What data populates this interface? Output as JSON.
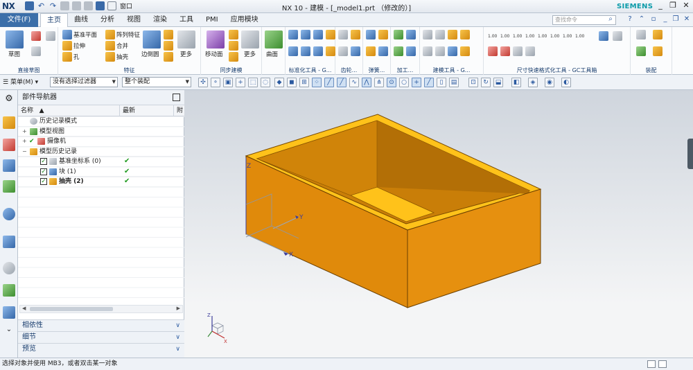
{
  "app": {
    "logo": "NX",
    "title": "NX 10 - 建模 - [_model1.prt （修改的）]",
    "brand": "SIEMENS",
    "window_menu": "窗口"
  },
  "ribbon_tabs": {
    "file": "文件(F)",
    "items": [
      "主页",
      "曲线",
      "分析",
      "视图",
      "渲染",
      "工具",
      "PMI",
      "应用模块"
    ],
    "active_index": 0,
    "search_placeholder": "查找命令"
  },
  "ribbon": {
    "sketch": "草图",
    "direct_sketch": "直接草图",
    "datum_plane": "基准平面",
    "pattern_feature": "阵列特征",
    "extrude": "拉伸",
    "unite": "合并",
    "hole": "孔",
    "shell": "抽壳",
    "feature": "特征",
    "edge_blend": "边倒圆",
    "more1": "更多",
    "move_face": "移动面",
    "more2": "更多",
    "sync_modeling": "同步建模",
    "surface": "曲面",
    "std_tools": "标准化工具 - G...",
    "gear": "齿轮...",
    "spring": "弹簧...",
    "machining": "加工...",
    "modeling_tools": "建模工具 - G...",
    "dimension_tools": "尺寸快速格式化工具 - GC工具箱",
    "assembly": "装配",
    "tiny_labels": [
      "1.00",
      "1.00",
      "1.00",
      "1.00",
      "1.00",
      "1.00",
      "1.00",
      "1.00"
    ]
  },
  "selection_bar": {
    "menu": "菜单(M)",
    "filter": "没有选择过滤器",
    "scope": "整个装配"
  },
  "navigator": {
    "title": "部件导航器",
    "col_name": "名称",
    "col_latest": "最新",
    "col_more": "附",
    "items": [
      {
        "label": "历史记录模式",
        "level": 0,
        "check": false,
        "ok": false,
        "bold": false
      },
      {
        "label": "模型视图",
        "level": 0,
        "check": false,
        "ok": false,
        "bold": false
      },
      {
        "label": "摄像机",
        "level": 0,
        "check": true,
        "ok": false,
        "bold": false
      },
      {
        "label": "模型历史记录",
        "level": 0,
        "check": false,
        "ok": false,
        "bold": false
      },
      {
        "label": "基准坐标系 (0)",
        "level": 1,
        "check": true,
        "ok": true,
        "bold": false
      },
      {
        "label": "块 (1)",
        "level": 1,
        "check": true,
        "ok": true,
        "bold": false
      },
      {
        "label": "抽壳 (2)",
        "level": 1,
        "check": true,
        "ok": true,
        "bold": true
      }
    ],
    "panels": [
      "相依性",
      "细节",
      "预览"
    ]
  },
  "viewport": {
    "axis_x": "X",
    "axis_y": "Y",
    "axis_z": "Z",
    "body_color": "#e08a0b",
    "top_color": "#ffc21a"
  },
  "status": {
    "prompt": "选择对象并使用 MB3，或者双击某一对象"
  }
}
